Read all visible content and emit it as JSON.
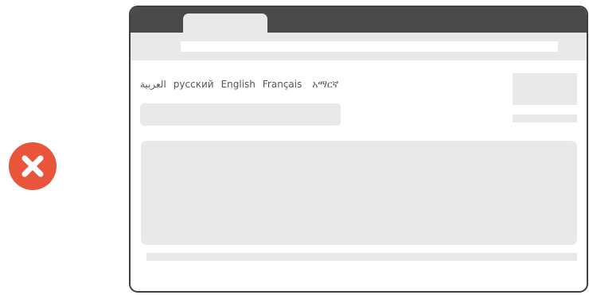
{
  "status": {
    "icon": "error-x-icon",
    "color": "#e8553b"
  },
  "languages": [
    {
      "code": "ar",
      "label": "العربية"
    },
    {
      "code": "ru",
      "label": "русский"
    },
    {
      "code": "en",
      "label": "English"
    },
    {
      "code": "fr",
      "label": "Français"
    },
    {
      "code": "am",
      "label": "አማርኛ"
    }
  ],
  "colors": {
    "titlebar": "#4a4a4a",
    "placeholder": "#e9e9e9",
    "text": "#555555"
  }
}
